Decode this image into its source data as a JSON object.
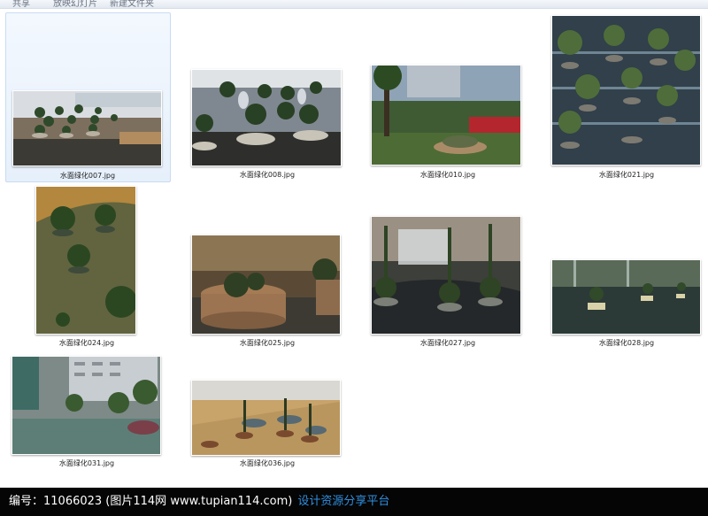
{
  "window": {
    "toolbar_items": [
      "共享",
      "放映幻灯片",
      "新建文件夹"
    ]
  },
  "files": [
    {
      "name": "水面绿化007.jpg",
      "selected": true
    },
    {
      "name": "水面绿化008.jpg",
      "selected": false
    },
    {
      "name": "水面绿化010.jpg",
      "selected": false
    },
    {
      "name": "水面绿化021.jpg",
      "selected": false
    },
    {
      "name": "水面绿化024.jpg",
      "selected": false
    },
    {
      "name": "水面绿化025.jpg",
      "selected": false
    },
    {
      "name": "水面绿化027.jpg",
      "selected": false
    },
    {
      "name": "水面绿化028.jpg",
      "selected": false
    },
    {
      "name": "水面绿化031.jpg",
      "selected": false
    },
    {
      "name": "水面绿化036.jpg",
      "selected": false
    }
  ],
  "footer": {
    "credit": "编号：11066023 (图片114网 www.tupian114.com)",
    "link": "设计资源分享平台"
  }
}
